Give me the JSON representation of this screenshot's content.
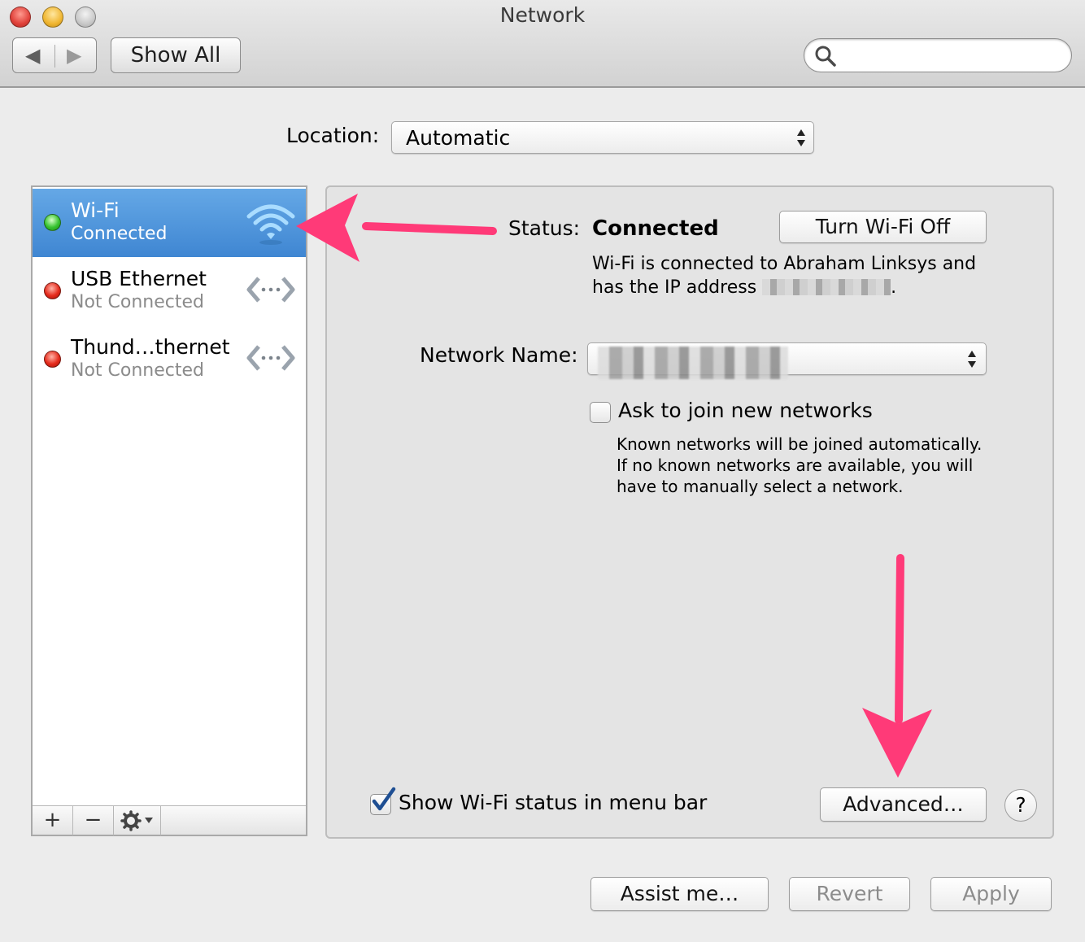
{
  "window": {
    "title": "Network"
  },
  "toolbar": {
    "show_all_label": "Show All",
    "back_icon": "chevron-left-icon",
    "forward_icon": "chevron-right-icon",
    "search": {
      "value": "",
      "placeholder": ""
    }
  },
  "location": {
    "label": "Location:",
    "value": "Automatic"
  },
  "sidebar": {
    "services": [
      {
        "name": "Wi-Fi",
        "status": "Connected",
        "indicator": "green",
        "icon": "wifi-icon",
        "selected": true
      },
      {
        "name": "USB Ethernet",
        "status": "Not Connected",
        "indicator": "red",
        "icon": "ethernet-icon",
        "selected": false
      },
      {
        "name": "Thund…thernet",
        "status": "Not Connected",
        "indicator": "red",
        "icon": "ethernet-icon",
        "selected": false
      }
    ],
    "add_label": "+",
    "remove_label": "−",
    "gear_icon": "gear-icon"
  },
  "detail": {
    "status_label": "Status:",
    "status_value": "Connected",
    "turn_off_label": "Turn Wi-Fi Off",
    "status_description_1": "Wi-Fi is connected to Abraham Linksys and",
    "status_description_2": "has the IP address",
    "status_description_end": ".",
    "network_name_label": "Network Name:",
    "ask_join_label": "Ask to join new networks",
    "ask_join_checked": false,
    "ask_join_help": "Known networks will be joined automatically. If no known networks are available, you will have to manually select a network.",
    "show_status_label": "Show Wi-Fi status in menu bar",
    "show_status_checked": true,
    "advanced_label": "Advanced…",
    "help_label": "?"
  },
  "footer": {
    "assist_label": "Assist me…",
    "revert_label": "Revert",
    "apply_label": "Apply"
  },
  "colors": {
    "selection": "#3f86d2",
    "annotation_arrow": "#ff3a78",
    "connected_indicator": "#36c330",
    "disconnected_indicator": "#e52b1c"
  }
}
